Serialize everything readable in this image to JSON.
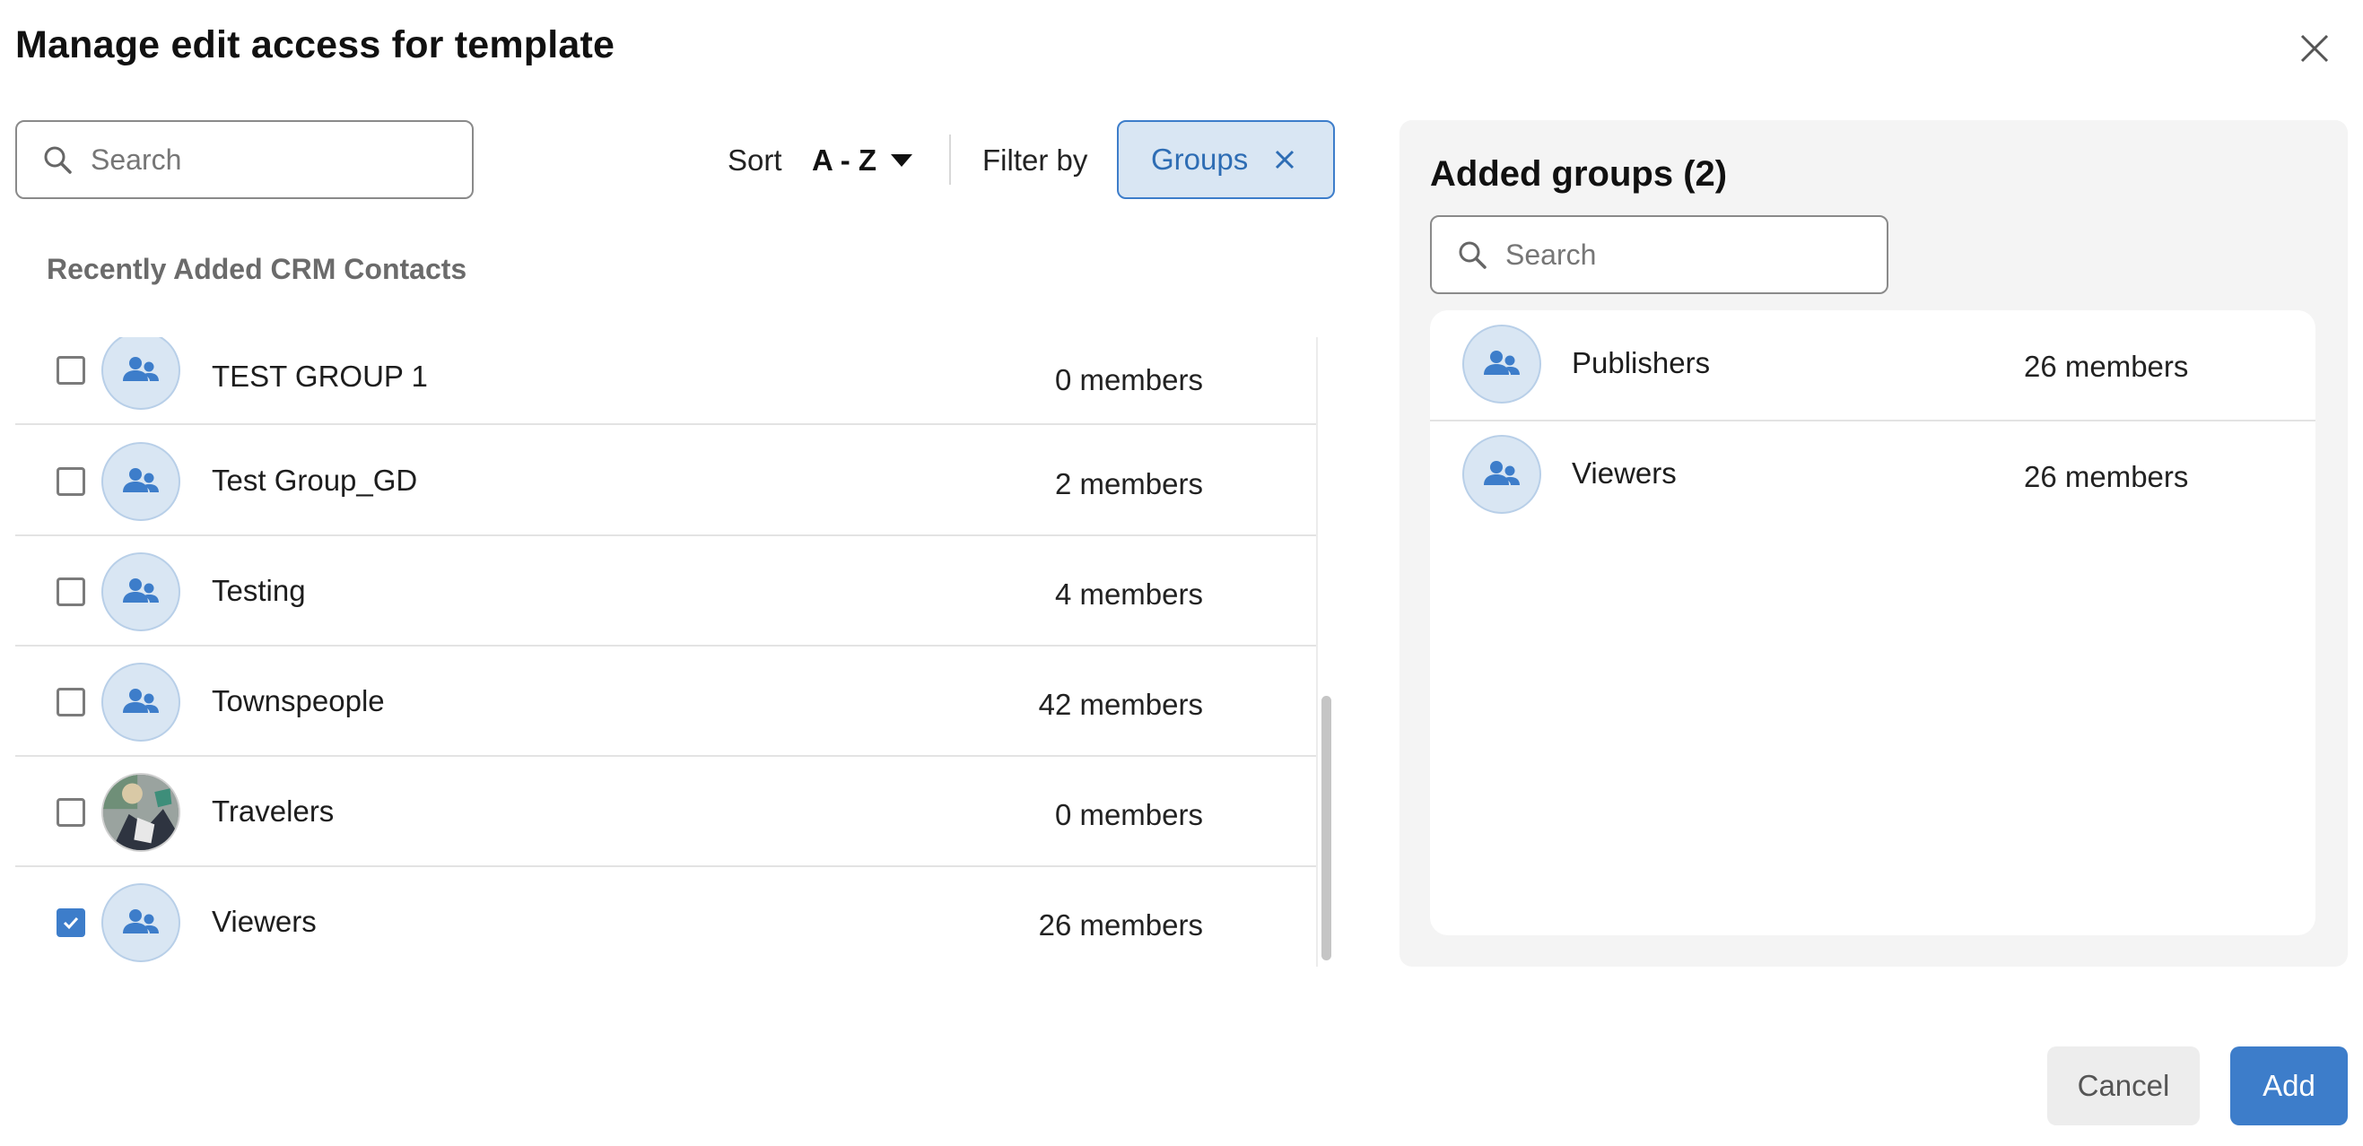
{
  "dialog": {
    "title": "Manage edit access for template"
  },
  "left": {
    "search": {
      "placeholder": "Search",
      "value": ""
    },
    "sort": {
      "label": "Sort",
      "value": "A - Z"
    },
    "filter": {
      "label": "Filter by",
      "chip": "Groups"
    },
    "section_heading": "Recently Added CRM Contacts",
    "rows": [
      {
        "name": "TEST GROUP 1",
        "members": "0 members",
        "checked": false,
        "avatar": "group-icon"
      },
      {
        "name": "Test Group_GD",
        "members": "2 members",
        "checked": false,
        "avatar": "group-icon"
      },
      {
        "name": "Testing",
        "members": "4 members",
        "checked": false,
        "avatar": "group-icon"
      },
      {
        "name": "Townspeople",
        "members": "42 members",
        "checked": false,
        "avatar": "group-icon"
      },
      {
        "name": "Travelers",
        "members": "0 members",
        "checked": false,
        "avatar": "photo"
      },
      {
        "name": "Viewers",
        "members": "26 members",
        "checked": true,
        "avatar": "group-icon"
      }
    ]
  },
  "right": {
    "title": "Added groups (2)",
    "search": {
      "placeholder": "Search",
      "value": ""
    },
    "rows": [
      {
        "name": "Publishers",
        "members": "26 members",
        "avatar": "group-icon"
      },
      {
        "name": "Viewers",
        "members": "26 members",
        "avatar": "group-icon"
      }
    ]
  },
  "footer": {
    "cancel_label": "Cancel",
    "add_label": "Add"
  },
  "colors": {
    "accent": "#3d7dca",
    "chip_bg": "#d9e6f3",
    "panel_bg": "#f4f4f4",
    "avatar_bg": "#d9e6f3"
  }
}
